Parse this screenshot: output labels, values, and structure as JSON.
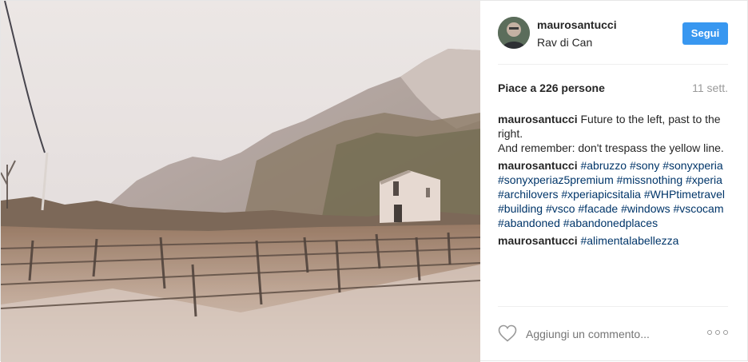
{
  "header": {
    "username": "maurosantucci",
    "location": "Rav di Can",
    "follow_label": "Segui"
  },
  "likes": {
    "text": "Piace a 226 persone",
    "time": "11 sett."
  },
  "comments": [
    {
      "user": "maurosantucci",
      "text": " Future to the left, past to the right.\nAnd remember: don't trespass the yellow line."
    },
    {
      "user": "maurosantucci",
      "hashtags": "#abruzzo #sony #sonyxperia #sonyxperiaz5premium #missnothing #xperia #archilovers #xperiapicsitalia #WHPtimetravel #building #vsco #facade #windows #vscocam #abandoned #abandonedplaces"
    },
    {
      "user": "maurosantucci",
      "hashtags": "#alimentalabellezza"
    }
  ],
  "comment_bar": {
    "placeholder": "Aggiungi un commento...",
    "like_icon": "heart-outline-icon",
    "more_icon": "more-options-icon"
  },
  "colors": {
    "accent": "#3897f0",
    "hashtag": "#003569",
    "muted": "#999999"
  }
}
